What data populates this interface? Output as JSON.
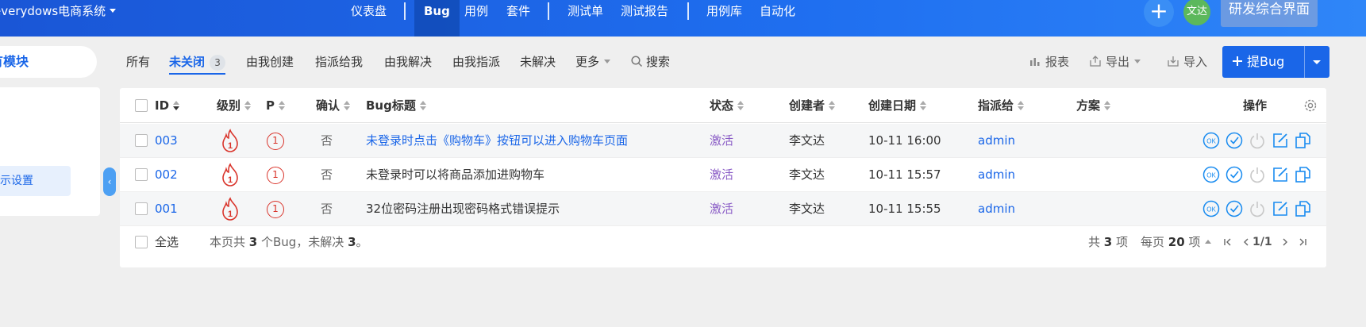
{
  "header": {
    "brand": "everydows电商系统",
    "nav": [
      "仪表盘",
      "Bug",
      "用例",
      "套件",
      "测试单",
      "测试报告",
      "用例库",
      "自动化"
    ],
    "avatar_text": "文达",
    "workspace": "研发综合界面"
  },
  "sidebar": {
    "module_title": "所有模块",
    "item": "显示设置",
    "collapse_icon": "‹"
  },
  "filters": {
    "all": "所有",
    "unclosed": "未关闭",
    "unclosed_count": "3",
    "created_by_me": "由我创建",
    "assigned_to_me": "指派给我",
    "resolved_by_me": "由我解决",
    "assigned_by_me": "由我指派",
    "unresolved": "未解决",
    "more": "更多",
    "search": "搜索"
  },
  "toolbar": {
    "report": "报表",
    "export": "导出",
    "import": "导入",
    "new_bug": "提Bug"
  },
  "table": {
    "headers": {
      "id": "ID",
      "severity": "级别",
      "pri": "P",
      "confirmed": "确认",
      "title": "Bug标题",
      "status": "状态",
      "creator": "创建者",
      "created_date": "创建日期",
      "assigned_to": "指派给",
      "resolution": "方案",
      "actions": "操作"
    },
    "rows": [
      {
        "id": "003",
        "severity": "1",
        "pri": "1",
        "confirmed": "否",
        "title": "未登录时点击《购物车》按钮可以进入购物车页面",
        "status": "激活",
        "creator": "李文达",
        "date": "10-11 16:00",
        "assigned": "admin"
      },
      {
        "id": "002",
        "severity": "1",
        "pri": "1",
        "confirmed": "否",
        "title": "未登录时可以将商品添加进购物车",
        "status": "激活",
        "creator": "李文达",
        "date": "10-11 15:57",
        "assigned": "admin"
      },
      {
        "id": "001",
        "severity": "1",
        "pri": "1",
        "confirmed": "否",
        "title": "32位密码注册出现密码格式错误提示",
        "status": "激活",
        "creator": "李文达",
        "date": "10-11 15:55",
        "assigned": "admin"
      }
    ]
  },
  "footer": {
    "select_all": "全选",
    "summary_pre": "本页共 ",
    "summary_count": "3",
    "summary_mid": " 个Bug，未解决 ",
    "summary_unresolved": "3",
    "summary_end": "。",
    "total_pre": "共 ",
    "total": "3",
    "total_post": " 项",
    "per_page_pre": "每页 ",
    "per_page": "20",
    "per_page_post": " 项",
    "page": "1/1"
  },
  "colors": {
    "accent": "#1a66e8",
    "status_active": "#8a5cc6",
    "severity_red": "#d9342b",
    "action_blue": "#1a8cf0"
  }
}
